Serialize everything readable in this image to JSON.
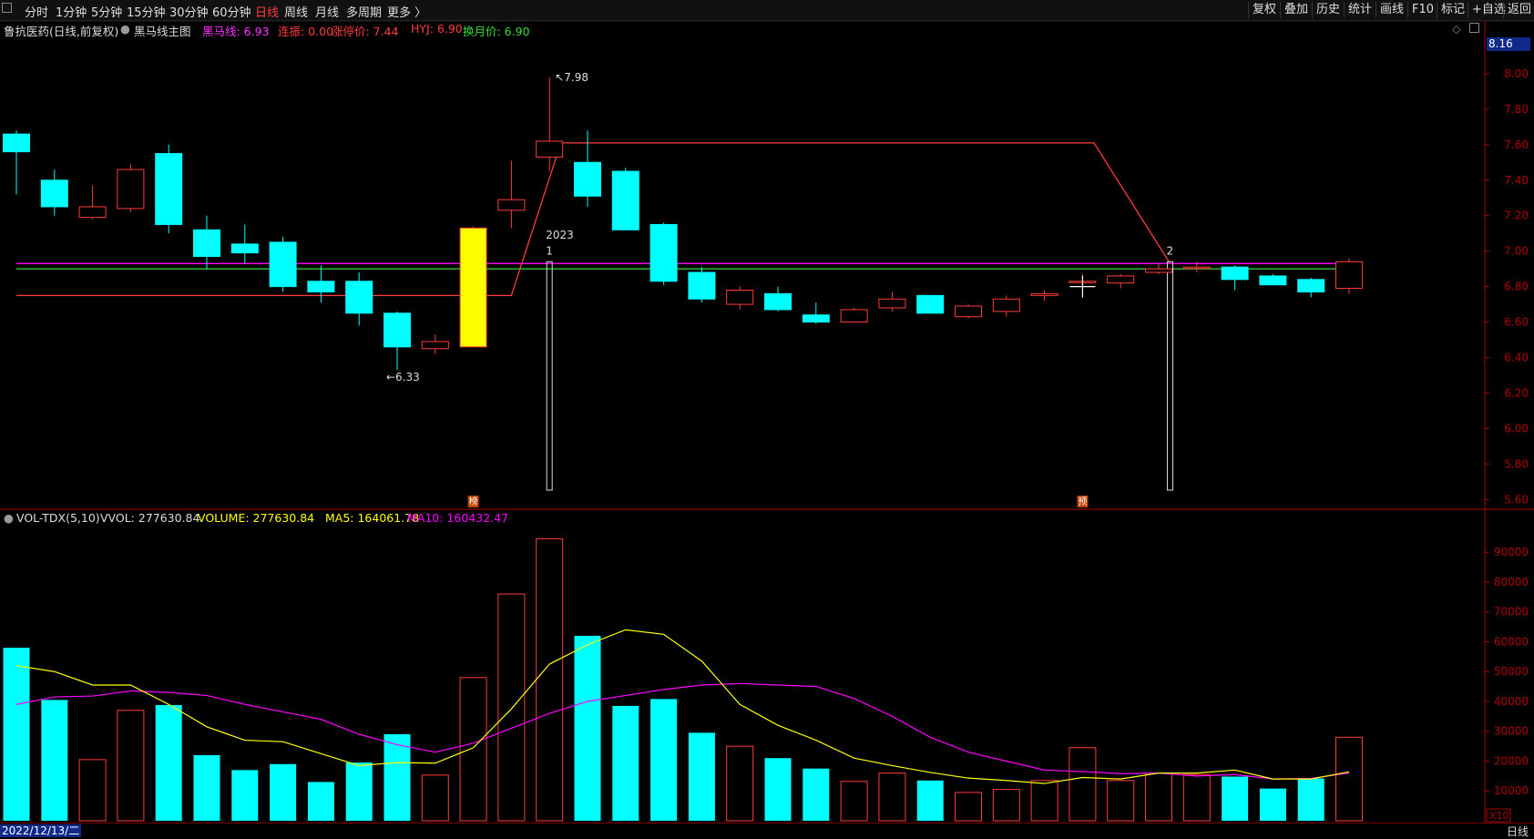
{
  "toolbar": {
    "left_items": [
      "分时",
      "1分钟",
      "5分钟",
      "15分钟",
      "30分钟",
      "60分钟",
      "日线",
      "周线",
      "月线",
      "多周期",
      "更多 〉"
    ],
    "active_item": "日线",
    "right_items": [
      "复权",
      "叠加",
      "历史",
      "统计",
      "画线",
      "F10",
      "标记",
      "+自选",
      "返回"
    ]
  },
  "info": {
    "stock": "鲁抗医药(日线,前复权)",
    "indicator": "黑马线主图",
    "heima": "黑马线: 6.93",
    "lianzhen": "连振: 0.00",
    "zhangting": "涨停价: 7.44",
    "hyj": "HYJ: 6.90",
    "huanyue": "换月价: 6.90"
  },
  "vol_info": {
    "name": "VOL-TDX(5,10)",
    "vvol": "VVOL: 277630.84",
    "volume": "VOLUME: 277630.84",
    "ma5": "MA5: 164061.78",
    "ma10": "MA10: 160432.47"
  },
  "footer": {
    "date": "2022/12/13/二",
    "period": "日线",
    "top_price_label": "8.16",
    "x10_label": "X10"
  },
  "colors": {
    "up": "#ff3b3b",
    "down": "#00ffff",
    "limit_candle": "#ffff00",
    "heima_line": "#ff00ff",
    "hyj_line": "#33dd33",
    "ma5": "#ffff00",
    "ma10": "#ff00ff",
    "axis": "#b00000"
  },
  "chart_data": [
    {
      "type": "candlestick",
      "title": "鲁抗医药 日线",
      "ylim": [
        5.55,
        8.2
      ],
      "yticks": [
        5.6,
        5.8,
        6.0,
        6.2,
        6.4,
        6.6,
        6.8,
        7.0,
        7.2,
        7.4,
        7.6,
        7.8,
        8.0
      ],
      "candles": [
        {
          "o": 7.66,
          "h": 7.68,
          "l": 7.32,
          "c": 7.56
        },
        {
          "o": 7.4,
          "h": 7.46,
          "l": 7.2,
          "c": 7.25
        },
        {
          "o": 7.19,
          "h": 7.37,
          "l": 7.18,
          "c": 7.25
        },
        {
          "o": 7.24,
          "h": 7.49,
          "l": 7.22,
          "c": 7.46
        },
        {
          "o": 7.55,
          "h": 7.6,
          "l": 7.1,
          "c": 7.15
        },
        {
          "o": 7.12,
          "h": 7.2,
          "l": 6.9,
          "c": 6.97
        },
        {
          "o": 7.04,
          "h": 7.15,
          "l": 6.93,
          "c": 6.99
        },
        {
          "o": 7.05,
          "h": 7.08,
          "l": 6.77,
          "c": 6.8
        },
        {
          "o": 6.83,
          "h": 6.92,
          "l": 6.71,
          "c": 6.77
        },
        {
          "o": 6.83,
          "h": 6.88,
          "l": 6.58,
          "c": 6.65
        },
        {
          "o": 6.65,
          "h": 6.66,
          "l": 6.33,
          "c": 6.46
        },
        {
          "o": 6.45,
          "h": 6.53,
          "l": 6.42,
          "c": 6.49
        },
        {
          "o": 6.46,
          "h": 7.14,
          "l": 6.46,
          "c": 7.13
        },
        {
          "o": 7.23,
          "h": 7.51,
          "l": 7.13,
          "c": 7.29
        },
        {
          "o": 7.53,
          "h": 7.98,
          "l": 7.45,
          "c": 7.62
        },
        {
          "o": 7.5,
          "h": 7.68,
          "l": 7.25,
          "c": 7.31
        },
        {
          "o": 7.45,
          "h": 7.47,
          "l": 7.12,
          "c": 7.12
        },
        {
          "o": 7.15,
          "h": 7.16,
          "l": 6.81,
          "c": 6.83
        },
        {
          "o": 6.88,
          "h": 6.91,
          "l": 6.71,
          "c": 6.73
        },
        {
          "o": 6.7,
          "h": 6.8,
          "l": 6.67,
          "c": 6.78
        },
        {
          "o": 6.76,
          "h": 6.8,
          "l": 6.66,
          "c": 6.67
        },
        {
          "o": 6.64,
          "h": 6.71,
          "l": 6.59,
          "c": 6.6
        },
        {
          "o": 6.6,
          "h": 6.68,
          "l": 6.6,
          "c": 6.67
        },
        {
          "o": 6.68,
          "h": 6.77,
          "l": 6.66,
          "c": 6.73
        },
        {
          "o": 6.75,
          "h": 6.75,
          "l": 6.65,
          "c": 6.65
        },
        {
          "o": 6.63,
          "h": 6.7,
          "l": 6.62,
          "c": 6.69
        },
        {
          "o": 6.66,
          "h": 6.75,
          "l": 6.63,
          "c": 6.73
        },
        {
          "o": 6.75,
          "h": 6.78,
          "l": 6.72,
          "c": 6.76
        },
        {
          "o": 6.83,
          "h": 6.87,
          "l": 6.77,
          "c": 6.83
        },
        {
          "o": 6.82,
          "h": 6.87,
          "l": 6.79,
          "c": 6.86
        },
        {
          "o": 6.88,
          "h": 6.93,
          "l": 6.87,
          "c": 6.9
        },
        {
          "o": 6.91,
          "h": 6.94,
          "l": 6.88,
          "c": 6.91
        },
        {
          "o": 6.91,
          "h": 6.92,
          "l": 6.78,
          "c": 6.84
        },
        {
          "o": 6.86,
          "h": 6.87,
          "l": 6.81,
          "c": 6.81
        },
        {
          "o": 6.84,
          "h": 6.85,
          "l": 6.74,
          "c": 6.77
        },
        {
          "o": 6.79,
          "h": 6.96,
          "l": 6.76,
          "c": 6.94
        }
      ],
      "heima_line": 6.93,
      "hyj_line": 6.9,
      "stepline": [
        {
          "i": 0,
          "v": 6.75
        },
        {
          "i": 13,
          "v": 6.75
        },
        {
          "i": 14.3,
          "v": 7.61
        },
        {
          "i": 28.3,
          "v": 7.61
        },
        {
          "i": 30.3,
          "v": 6.93
        }
      ],
      "annotations": [
        {
          "i": 14,
          "text": "7.98",
          "price": 7.98
        },
        {
          "i": 10,
          "text": "6.33",
          "price": 6.33
        },
        {
          "i": 14,
          "text": "2023",
          "price": 7.07
        },
        {
          "i": 14,
          "text": "1",
          "price": 6.99
        },
        {
          "i": 30.3,
          "text": "2",
          "price": 6.99
        }
      ],
      "markers": [
        {
          "i": 12,
          "text": "榜"
        },
        {
          "i": 28,
          "text": "预"
        }
      ],
      "verticals": [
        14,
        30.3
      ],
      "cursor_index": 28
    },
    {
      "type": "bar",
      "title": "VOL-TDX(5,10)",
      "ylim": [
        0,
        98000
      ],
      "yticks": [
        10000,
        20000,
        30000,
        40000,
        50000,
        60000,
        70000,
        80000,
        90000
      ],
      "volume": [
        58000,
        40500,
        20500,
        37000,
        38800,
        22000,
        17000,
        19000,
        13000,
        19500,
        29000,
        15300,
        48000,
        76000,
        94500,
        62000,
        38500,
        40800,
        29500,
        25000,
        21000,
        17500,
        13200,
        16000,
        13500,
        9500,
        10500,
        13500,
        24500,
        13500,
        16000,
        15500,
        14800,
        10800,
        14200,
        28000
      ],
      "ma5": [
        52000,
        50000,
        45500,
        45500,
        39000,
        31500,
        27000,
        26500,
        22500,
        18500,
        19500,
        19300,
        24500,
        37500,
        52500,
        59000,
        64000,
        62500,
        53500,
        39000,
        32000,
        27000,
        21000,
        18500,
        16200,
        14300,
        13500,
        12500,
        14500,
        14000,
        16000,
        16000,
        17000,
        14000,
        14000,
        16400
      ],
      "ma10": [
        39000,
        41500,
        41800,
        43500,
        43000,
        42000,
        39000,
        36500,
        34000,
        29000,
        25500,
        23000,
        26000,
        31000,
        36000,
        40000,
        42000,
        44000,
        45500,
        46000,
        45500,
        45000,
        41000,
        35000,
        28000,
        23000,
        20000,
        17000,
        16500,
        15800,
        16000,
        15000,
        15500,
        14000,
        14200,
        16000
      ]
    }
  ]
}
